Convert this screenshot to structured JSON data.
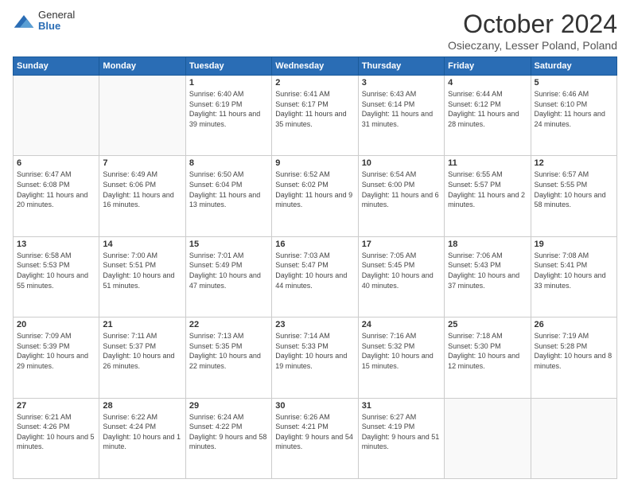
{
  "header": {
    "logo_general": "General",
    "logo_blue": "Blue",
    "month_title": "October 2024",
    "location": "Osieczany, Lesser Poland, Poland"
  },
  "days_of_week": [
    "Sunday",
    "Monday",
    "Tuesday",
    "Wednesday",
    "Thursday",
    "Friday",
    "Saturday"
  ],
  "weeks": [
    [
      {
        "day": "",
        "detail": ""
      },
      {
        "day": "",
        "detail": ""
      },
      {
        "day": "1",
        "detail": "Sunrise: 6:40 AM\nSunset: 6:19 PM\nDaylight: 11 hours and 39 minutes."
      },
      {
        "day": "2",
        "detail": "Sunrise: 6:41 AM\nSunset: 6:17 PM\nDaylight: 11 hours and 35 minutes."
      },
      {
        "day": "3",
        "detail": "Sunrise: 6:43 AM\nSunset: 6:14 PM\nDaylight: 11 hours and 31 minutes."
      },
      {
        "day": "4",
        "detail": "Sunrise: 6:44 AM\nSunset: 6:12 PM\nDaylight: 11 hours and 28 minutes."
      },
      {
        "day": "5",
        "detail": "Sunrise: 6:46 AM\nSunset: 6:10 PM\nDaylight: 11 hours and 24 minutes."
      }
    ],
    [
      {
        "day": "6",
        "detail": "Sunrise: 6:47 AM\nSunset: 6:08 PM\nDaylight: 11 hours and 20 minutes."
      },
      {
        "day": "7",
        "detail": "Sunrise: 6:49 AM\nSunset: 6:06 PM\nDaylight: 11 hours and 16 minutes."
      },
      {
        "day": "8",
        "detail": "Sunrise: 6:50 AM\nSunset: 6:04 PM\nDaylight: 11 hours and 13 minutes."
      },
      {
        "day": "9",
        "detail": "Sunrise: 6:52 AM\nSunset: 6:02 PM\nDaylight: 11 hours and 9 minutes."
      },
      {
        "day": "10",
        "detail": "Sunrise: 6:54 AM\nSunset: 6:00 PM\nDaylight: 11 hours and 6 minutes."
      },
      {
        "day": "11",
        "detail": "Sunrise: 6:55 AM\nSunset: 5:57 PM\nDaylight: 11 hours and 2 minutes."
      },
      {
        "day": "12",
        "detail": "Sunrise: 6:57 AM\nSunset: 5:55 PM\nDaylight: 10 hours and 58 minutes."
      }
    ],
    [
      {
        "day": "13",
        "detail": "Sunrise: 6:58 AM\nSunset: 5:53 PM\nDaylight: 10 hours and 55 minutes."
      },
      {
        "day": "14",
        "detail": "Sunrise: 7:00 AM\nSunset: 5:51 PM\nDaylight: 10 hours and 51 minutes."
      },
      {
        "day": "15",
        "detail": "Sunrise: 7:01 AM\nSunset: 5:49 PM\nDaylight: 10 hours and 47 minutes."
      },
      {
        "day": "16",
        "detail": "Sunrise: 7:03 AM\nSunset: 5:47 PM\nDaylight: 10 hours and 44 minutes."
      },
      {
        "day": "17",
        "detail": "Sunrise: 7:05 AM\nSunset: 5:45 PM\nDaylight: 10 hours and 40 minutes."
      },
      {
        "day": "18",
        "detail": "Sunrise: 7:06 AM\nSunset: 5:43 PM\nDaylight: 10 hours and 37 minutes."
      },
      {
        "day": "19",
        "detail": "Sunrise: 7:08 AM\nSunset: 5:41 PM\nDaylight: 10 hours and 33 minutes."
      }
    ],
    [
      {
        "day": "20",
        "detail": "Sunrise: 7:09 AM\nSunset: 5:39 PM\nDaylight: 10 hours and 29 minutes."
      },
      {
        "day": "21",
        "detail": "Sunrise: 7:11 AM\nSunset: 5:37 PM\nDaylight: 10 hours and 26 minutes."
      },
      {
        "day": "22",
        "detail": "Sunrise: 7:13 AM\nSunset: 5:35 PM\nDaylight: 10 hours and 22 minutes."
      },
      {
        "day": "23",
        "detail": "Sunrise: 7:14 AM\nSunset: 5:33 PM\nDaylight: 10 hours and 19 minutes."
      },
      {
        "day": "24",
        "detail": "Sunrise: 7:16 AM\nSunset: 5:32 PM\nDaylight: 10 hours and 15 minutes."
      },
      {
        "day": "25",
        "detail": "Sunrise: 7:18 AM\nSunset: 5:30 PM\nDaylight: 10 hours and 12 minutes."
      },
      {
        "day": "26",
        "detail": "Sunrise: 7:19 AM\nSunset: 5:28 PM\nDaylight: 10 hours and 8 minutes."
      }
    ],
    [
      {
        "day": "27",
        "detail": "Sunrise: 6:21 AM\nSunset: 4:26 PM\nDaylight: 10 hours and 5 minutes."
      },
      {
        "day": "28",
        "detail": "Sunrise: 6:22 AM\nSunset: 4:24 PM\nDaylight: 10 hours and 1 minute."
      },
      {
        "day": "29",
        "detail": "Sunrise: 6:24 AM\nSunset: 4:22 PM\nDaylight: 9 hours and 58 minutes."
      },
      {
        "day": "30",
        "detail": "Sunrise: 6:26 AM\nSunset: 4:21 PM\nDaylight: 9 hours and 54 minutes."
      },
      {
        "day": "31",
        "detail": "Sunrise: 6:27 AM\nSunset: 4:19 PM\nDaylight: 9 hours and 51 minutes."
      },
      {
        "day": "",
        "detail": ""
      },
      {
        "day": "",
        "detail": ""
      }
    ]
  ]
}
